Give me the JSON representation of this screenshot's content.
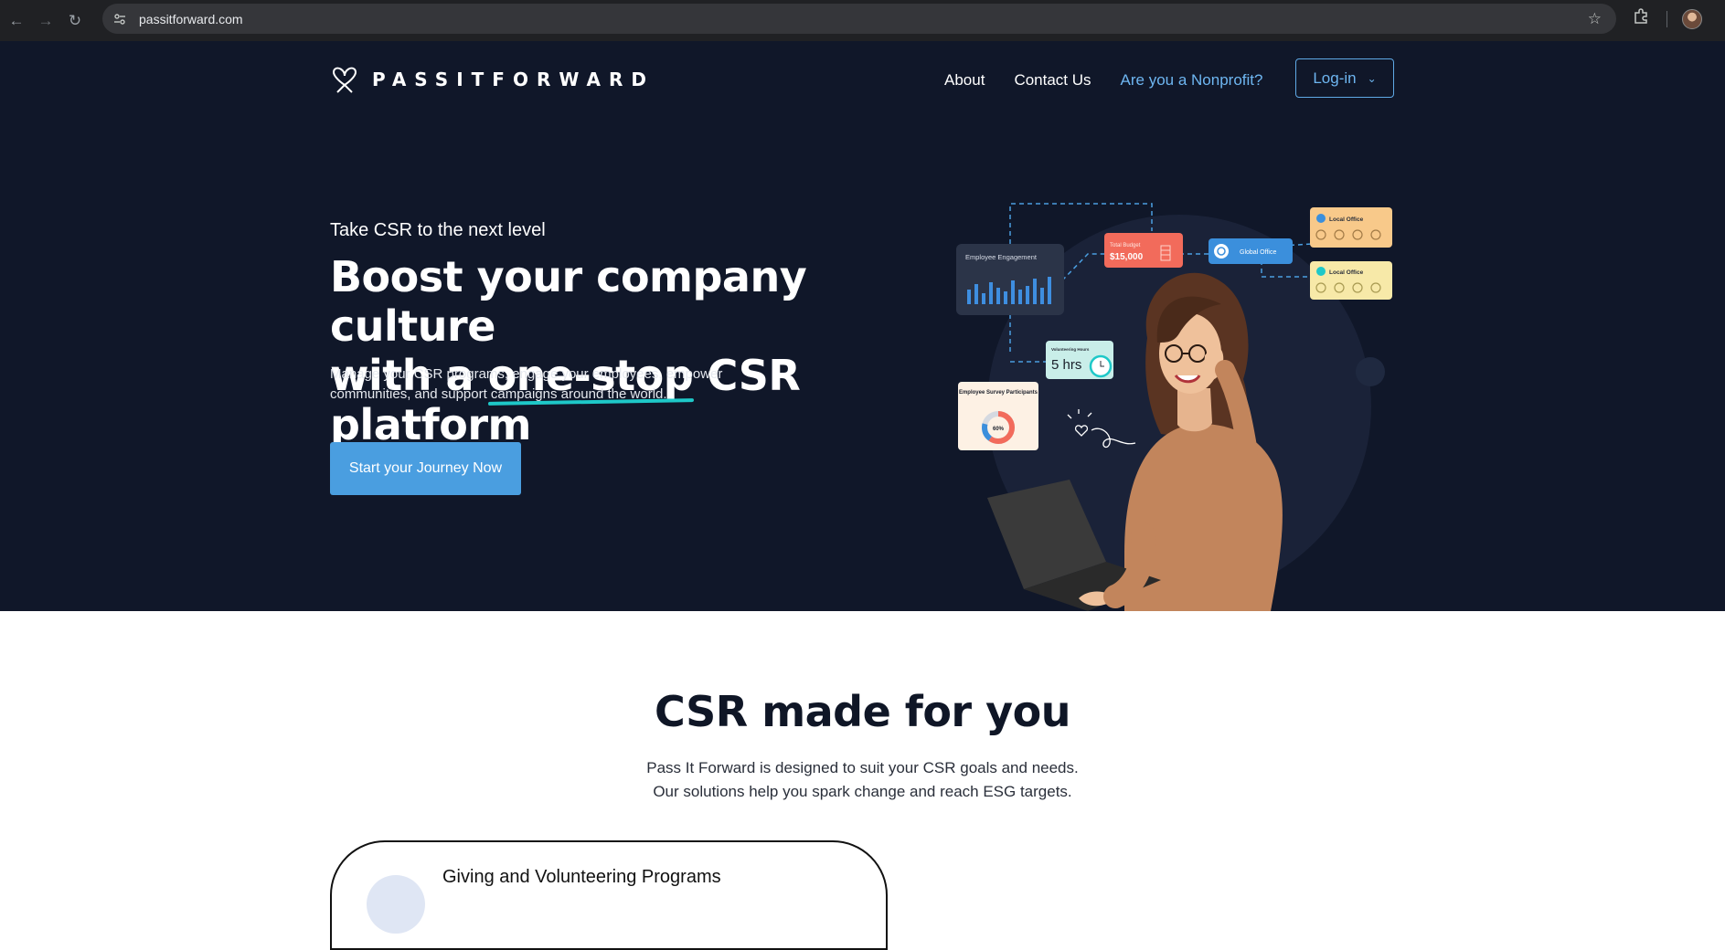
{
  "browser": {
    "url": "passitforward.com",
    "icons": [
      "back-icon",
      "forward-icon",
      "reload-icon",
      "site-info-icon",
      "bookmark-star-icon",
      "extensions-icon",
      "profile-avatar"
    ]
  },
  "brand": {
    "name": "PASSITFORWARD"
  },
  "nav": {
    "about": "About",
    "contact": "Contact Us",
    "nonprofit": "Are you a Nonprofit?",
    "login": "Log-in"
  },
  "hero": {
    "eyebrow": "Take CSR to the next level",
    "headline_line1": "Boost your company culture",
    "headline_prefix": "with a ",
    "headline_highlight": "one-stop",
    "headline_suffix": " CSR platform",
    "subtitle": "Manage your CSR programs, engage your employees, empower communities, and support campaigns around the world.",
    "cta": "Start your Journey Now"
  },
  "illustration": {
    "employee_engagement": "Employee Engagement",
    "total_budget_label": "Total Budget",
    "total_budget_value": "$15,000",
    "global_office": "Global Office",
    "local_office_1": "Local Office",
    "local_office_2": "Local Office",
    "volunteering_hours_label": "Volunteering Hours",
    "volunteering_hours_value": "5 hrs",
    "survey_label": "Employee Survey Participants",
    "survey_value": "60%"
  },
  "section2": {
    "title": "CSR made for you",
    "subtitle_line1": "Pass It Forward is designed to suit your CSR goals and needs.",
    "subtitle_line2": "Our solutions help you spark change and reach ESG targets.",
    "card_title": "Giving and Volunteering Programs"
  },
  "colors": {
    "hero_bg": "#101729",
    "accent_blue": "#4a9ee0",
    "underline_teal": "#1ec8c8",
    "budget_card": "#f26b5b",
    "local_office_orange": "#f8c98a",
    "local_office_yellow": "#f7e9a8"
  }
}
